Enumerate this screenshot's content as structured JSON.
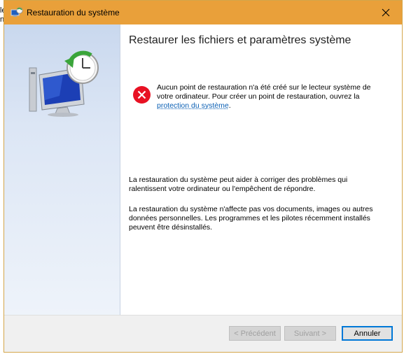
{
  "window": {
    "title": "Restauration du système",
    "close_glyph": "✕"
  },
  "background_fragment": [
    "le",
    "n"
  ],
  "main": {
    "heading": "Restaurer les fichiers et paramètres système",
    "error_text_1": "Aucun point de restauration n'a été créé sur le lecteur système de votre ordinateur. Pour créer un point de restauration, ouvrez la ",
    "error_link": "protection du système",
    "error_text_2": ".",
    "para1": "La restauration du système peut aider à corriger des problèmes qui ralentissent votre ordinateur ou l'empêchent de répondre.",
    "para2": "La restauration du système n'affecte pas vos documents, images ou autres données personnelles. Les programmes et les pilotes récemment installés peuvent être désinstallés."
  },
  "footer": {
    "prev_label": "< Précédent",
    "next_label": "Suivant >",
    "cancel_label": "Annuler"
  },
  "icons": {
    "title": "system-restore-icon",
    "hero": "system-restore-hero-icon",
    "error": "error-icon",
    "close": "close-icon"
  },
  "colors": {
    "titlebar": "#e9a03a",
    "link": "#0a5fb4",
    "error": "#e81123"
  }
}
